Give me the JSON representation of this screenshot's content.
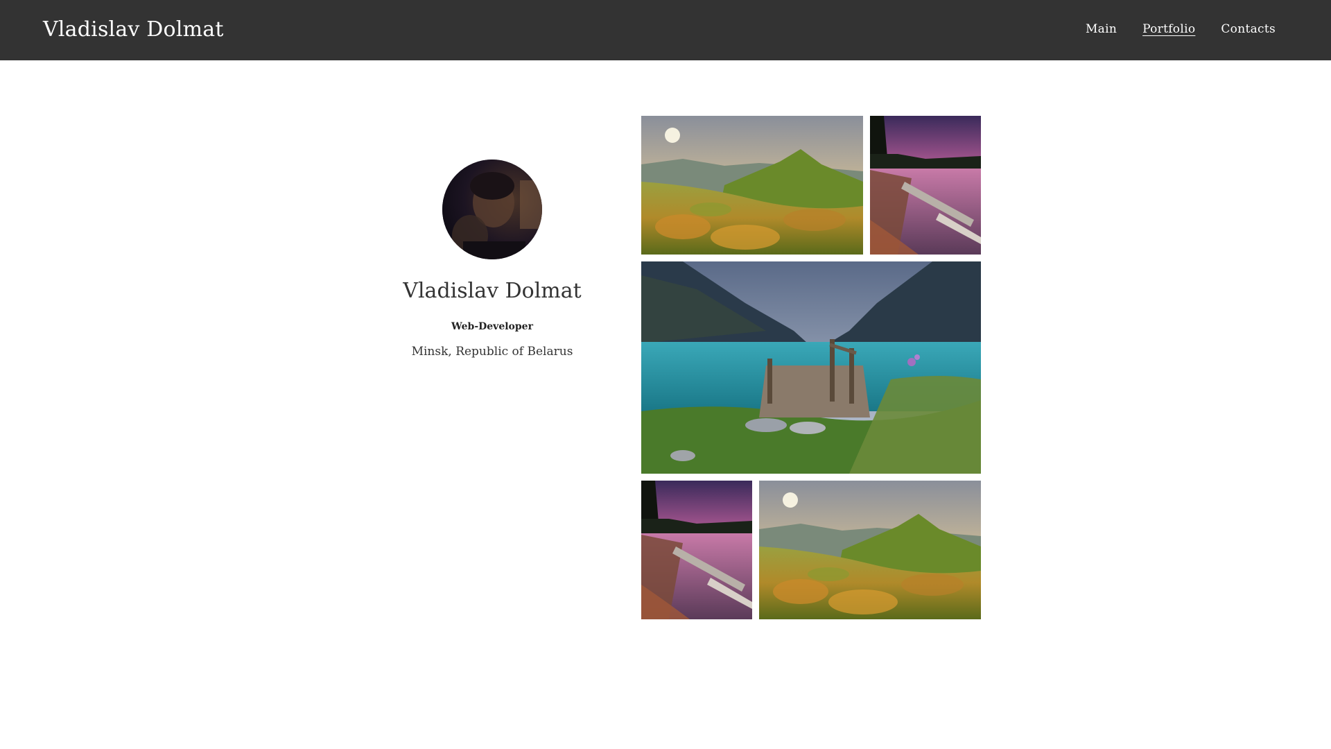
{
  "header": {
    "brand": "Vladislav Dolmat",
    "nav": [
      {
        "label": "Main",
        "active": false
      },
      {
        "label": "Portfolio",
        "active": true
      },
      {
        "label": "Contacts",
        "active": false
      }
    ]
  },
  "profile": {
    "name": "Vladislav Dolmat",
    "role": "Web-Developer",
    "location": "Minsk, Republic of Belarus"
  },
  "gallery": {
    "photos": [
      {
        "subject": "mountain-meadow-sunrise"
      },
      {
        "subject": "pink-sky-forest-lake"
      },
      {
        "subject": "turquoise-lake-wooden-pier"
      },
      {
        "subject": "pink-sky-forest-lake"
      },
      {
        "subject": "mountain-meadow-sunrise"
      }
    ]
  },
  "colors": {
    "header_bg": "#333333",
    "header_text": "#ffffff",
    "page_bg": "#ffffff",
    "body_text": "#333333"
  }
}
